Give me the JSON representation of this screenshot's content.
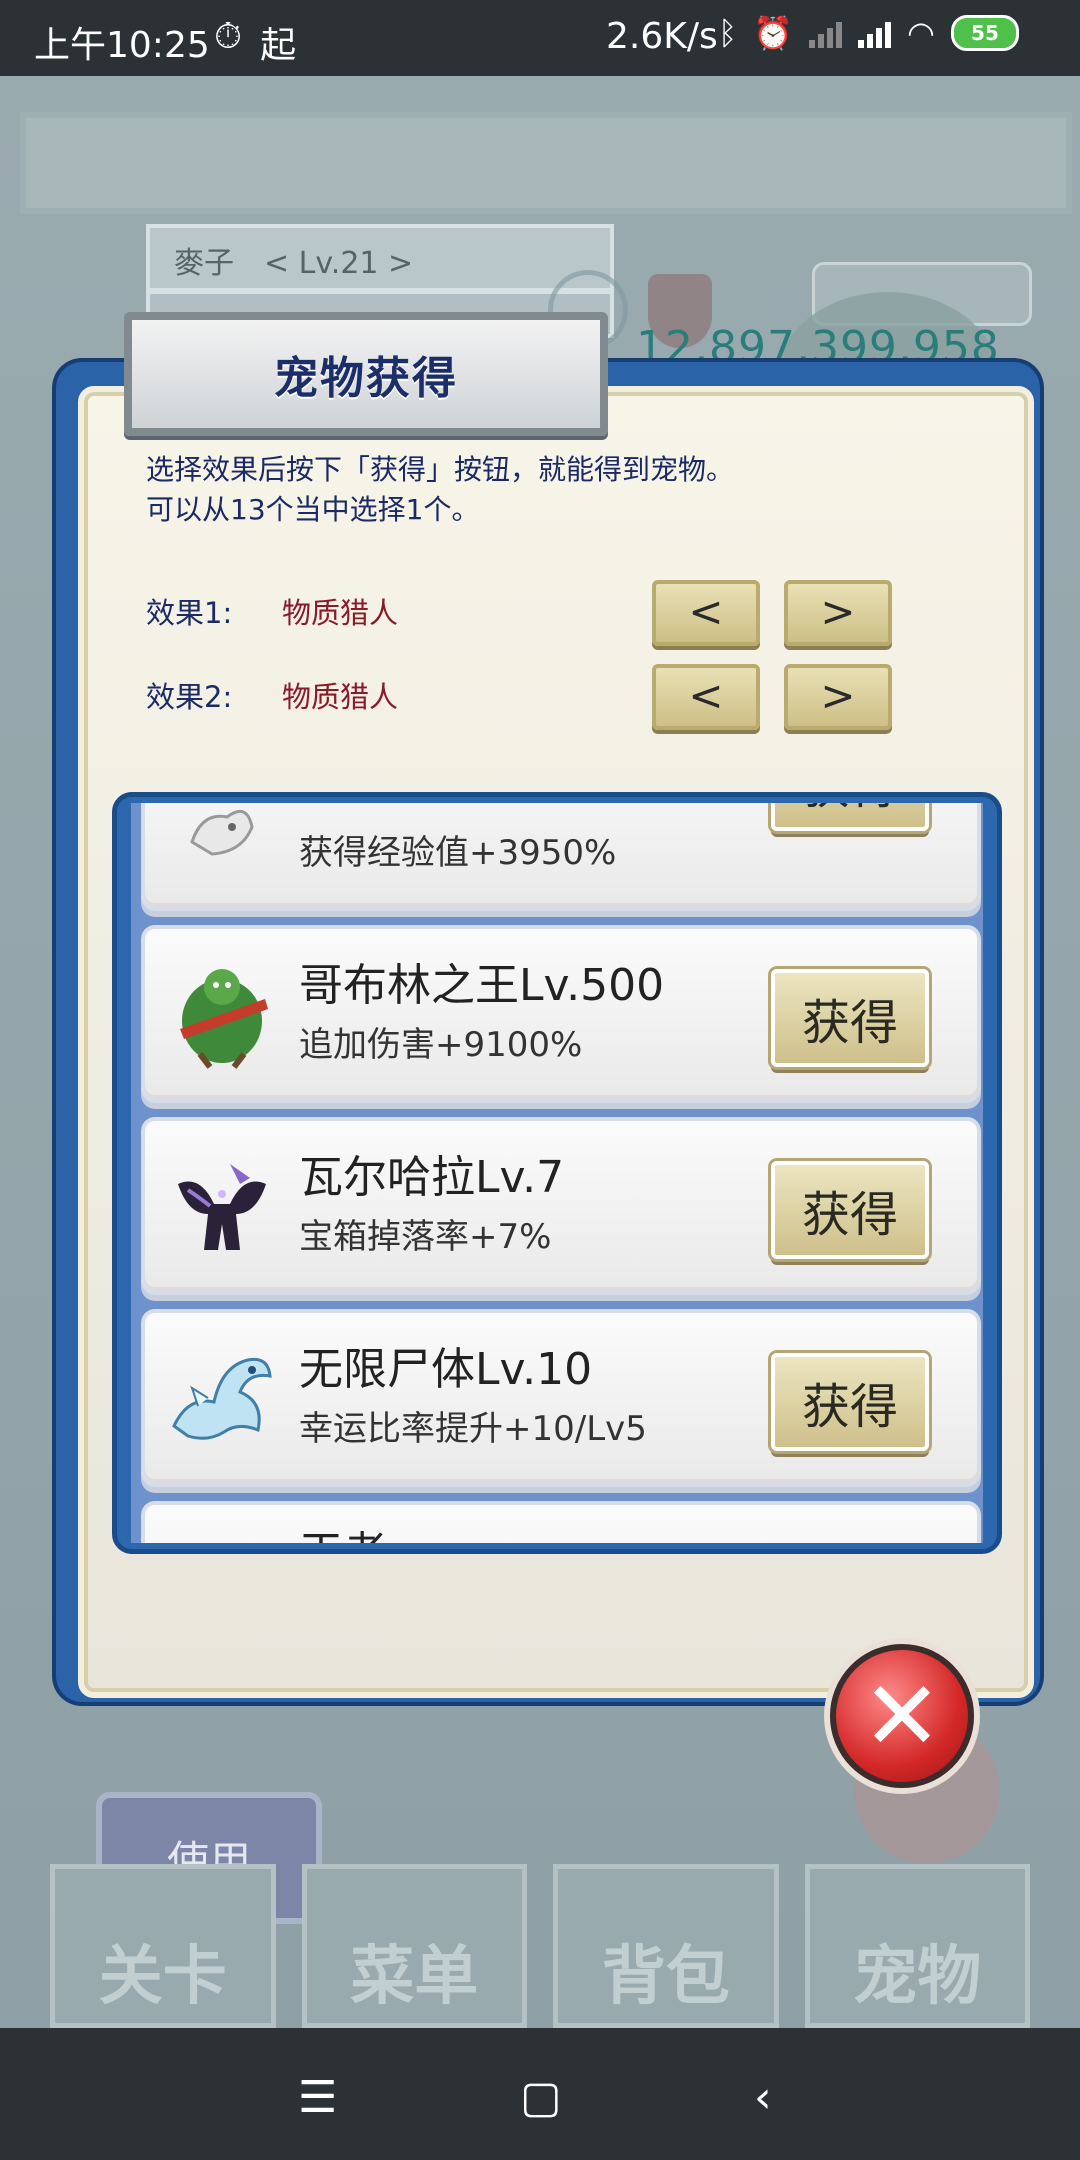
{
  "status_bar": {
    "time": "上午10:25",
    "icons_left": [
      "alarm-clock-icon",
      "起"
    ],
    "net_speed": "2.6K/s",
    "battery": "55"
  },
  "background": {
    "player_name": "麥子　< Lv.21 >",
    "gold": "12,897,399,958",
    "use_button": "使用",
    "nav_tabs": [
      "关卡",
      "菜单",
      "背包",
      "宠物"
    ]
  },
  "dialog": {
    "title": "宠物获得",
    "instructions": [
      "选择效果后按下「获得」按钮，就能得到宠物。",
      "可以从13个当中选择1个。"
    ],
    "effects": [
      {
        "label": "效果1:",
        "value": "物质猎人",
        "prev": "<",
        "next": ">"
      },
      {
        "label": "效果2:",
        "value": "物质猎人",
        "prev": "<",
        "next": ">"
      }
    ],
    "pets": [
      {
        "name": "",
        "effect": "获得经验值+3950%",
        "button": "获得",
        "icon": "white-dragon-icon"
      },
      {
        "name": "哥布林之王Lv.500",
        "effect": "追加伤害+9100%",
        "button": "获得",
        "icon": "goblin-king-icon"
      },
      {
        "name": "瓦尔哈拉Lv.7",
        "effect": "宝箱掉落率+7%",
        "button": "获得",
        "icon": "valhalla-dark-creature-icon"
      },
      {
        "name": "无限尸体Lv.10",
        "effect": "幸运比率提升+10/Lv5",
        "button": "获得",
        "icon": "ice-dragon-icon"
      },
      {
        "name": "王者",
        "effect": "",
        "button": "",
        "icon": ""
      }
    ],
    "close_icon": "close-icon"
  },
  "nav_bar": {
    "icons": [
      "menu-icon",
      "home-icon",
      "back-icon"
    ]
  }
}
